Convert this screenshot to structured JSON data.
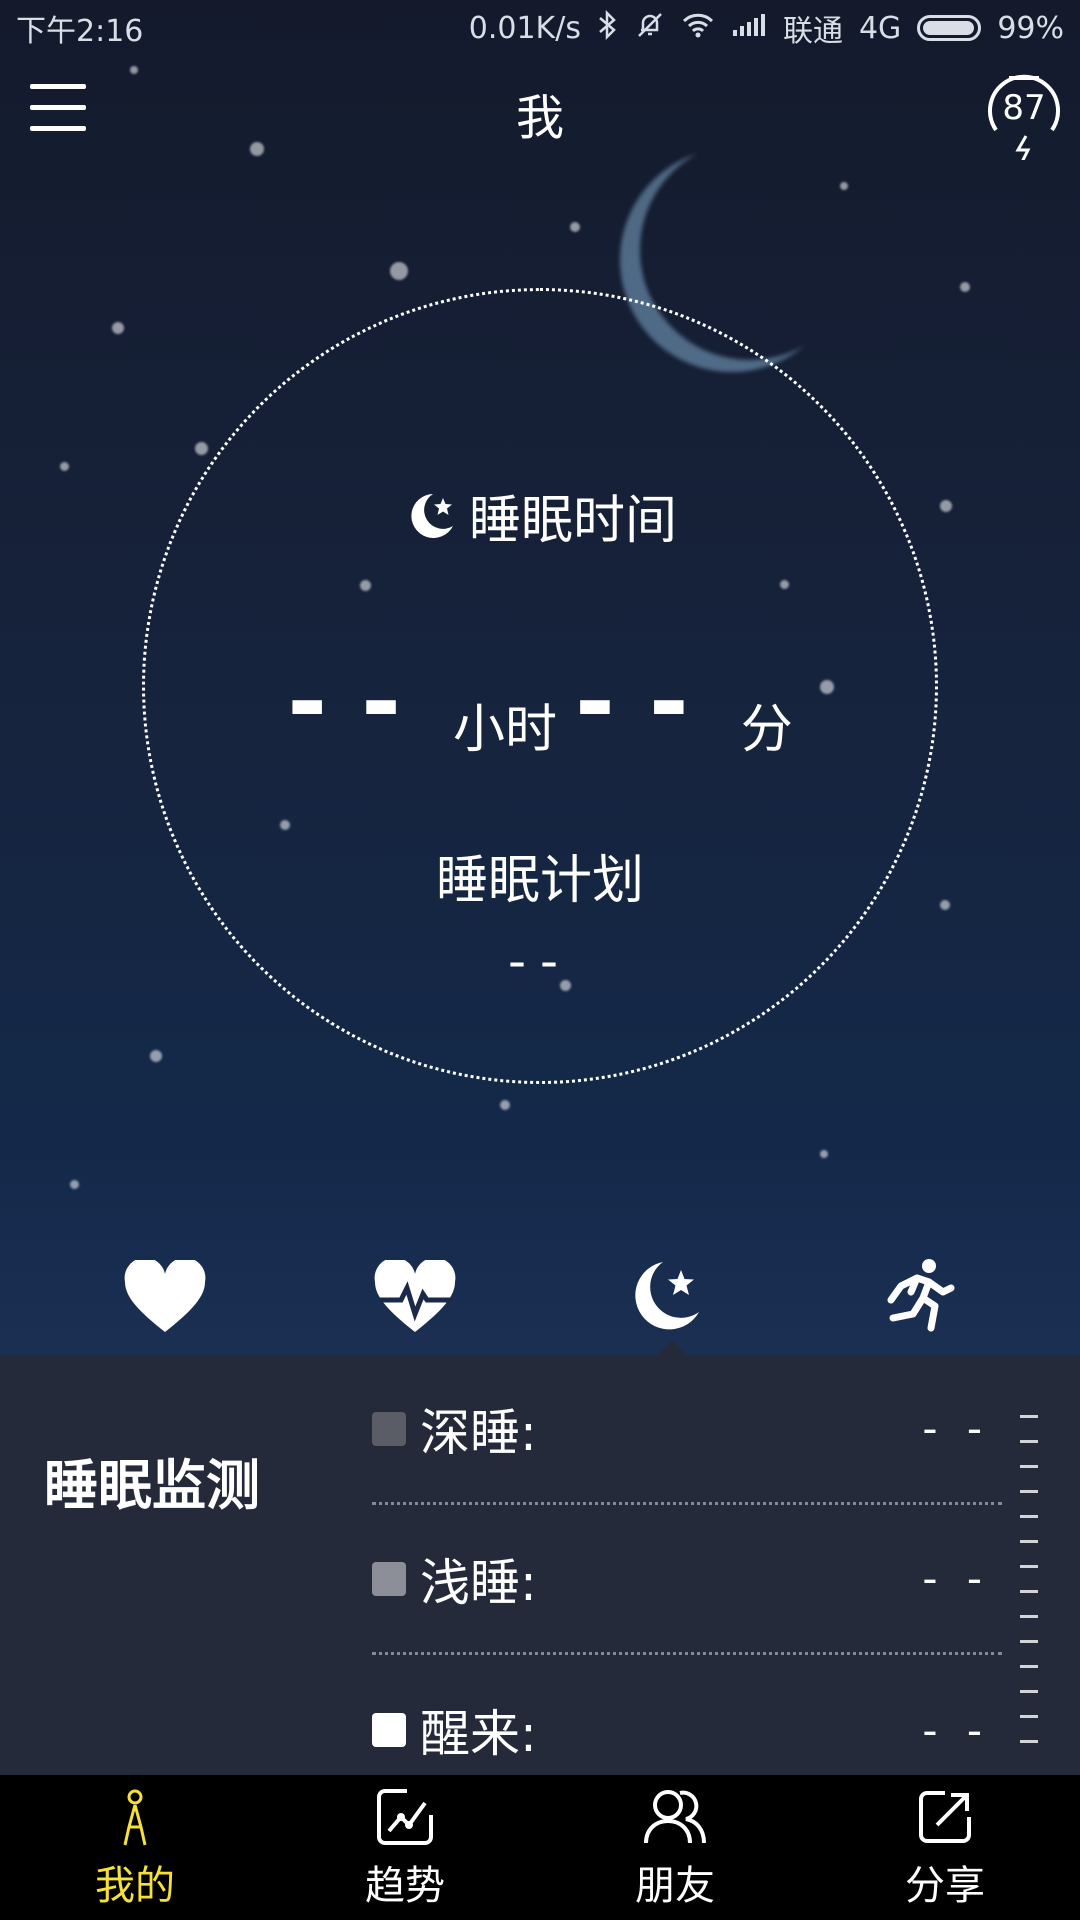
{
  "status_bar": {
    "time": "下午2:16",
    "network_speed": "0.01K/s",
    "carrier": "联通",
    "network_type": "4G",
    "battery": "99%",
    "icons": [
      "bluetooth-icon",
      "mute-icon",
      "wifi-icon",
      "signal-icon",
      "battery-icon"
    ]
  },
  "header": {
    "title": "我",
    "device_badge": "87",
    "menu_icon": "hamburger-icon",
    "badge_icon": "watch-charging-icon"
  },
  "sleep": {
    "label": "睡眠时间",
    "label_icon": "moon-star-icon",
    "hours_value": "--",
    "hours_unit": "小时",
    "minutes_value": "--",
    "minutes_unit": "分",
    "plan_label": "睡眠计划",
    "plan_value": "--"
  },
  "metric_tabs": [
    {
      "icon": "heart-icon"
    },
    {
      "icon": "heart-rate-icon"
    },
    {
      "icon": "moon-star-icon",
      "active": true
    },
    {
      "icon": "running-icon"
    }
  ],
  "panel": {
    "title": "睡眠监测",
    "stages": [
      {
        "label": "深睡:",
        "value": "- -",
        "color": "#5a5c66"
      },
      {
        "label": "浅睡:",
        "value": "- -",
        "color": "#8d8f98"
      },
      {
        "label": "醒来:",
        "value": "- -",
        "color": "#ffffff"
      }
    ]
  },
  "bottom_nav": [
    {
      "label": "我的",
      "icon": "person-icon",
      "active": true
    },
    {
      "label": "趋势",
      "icon": "trend-icon"
    },
    {
      "label": "朋友",
      "icon": "friends-icon"
    },
    {
      "label": "分享",
      "icon": "share-icon"
    }
  ],
  "colors": {
    "active_nav": "#f5e13a",
    "nav_bg": "#000000",
    "panel_bg": "#262a3a"
  }
}
